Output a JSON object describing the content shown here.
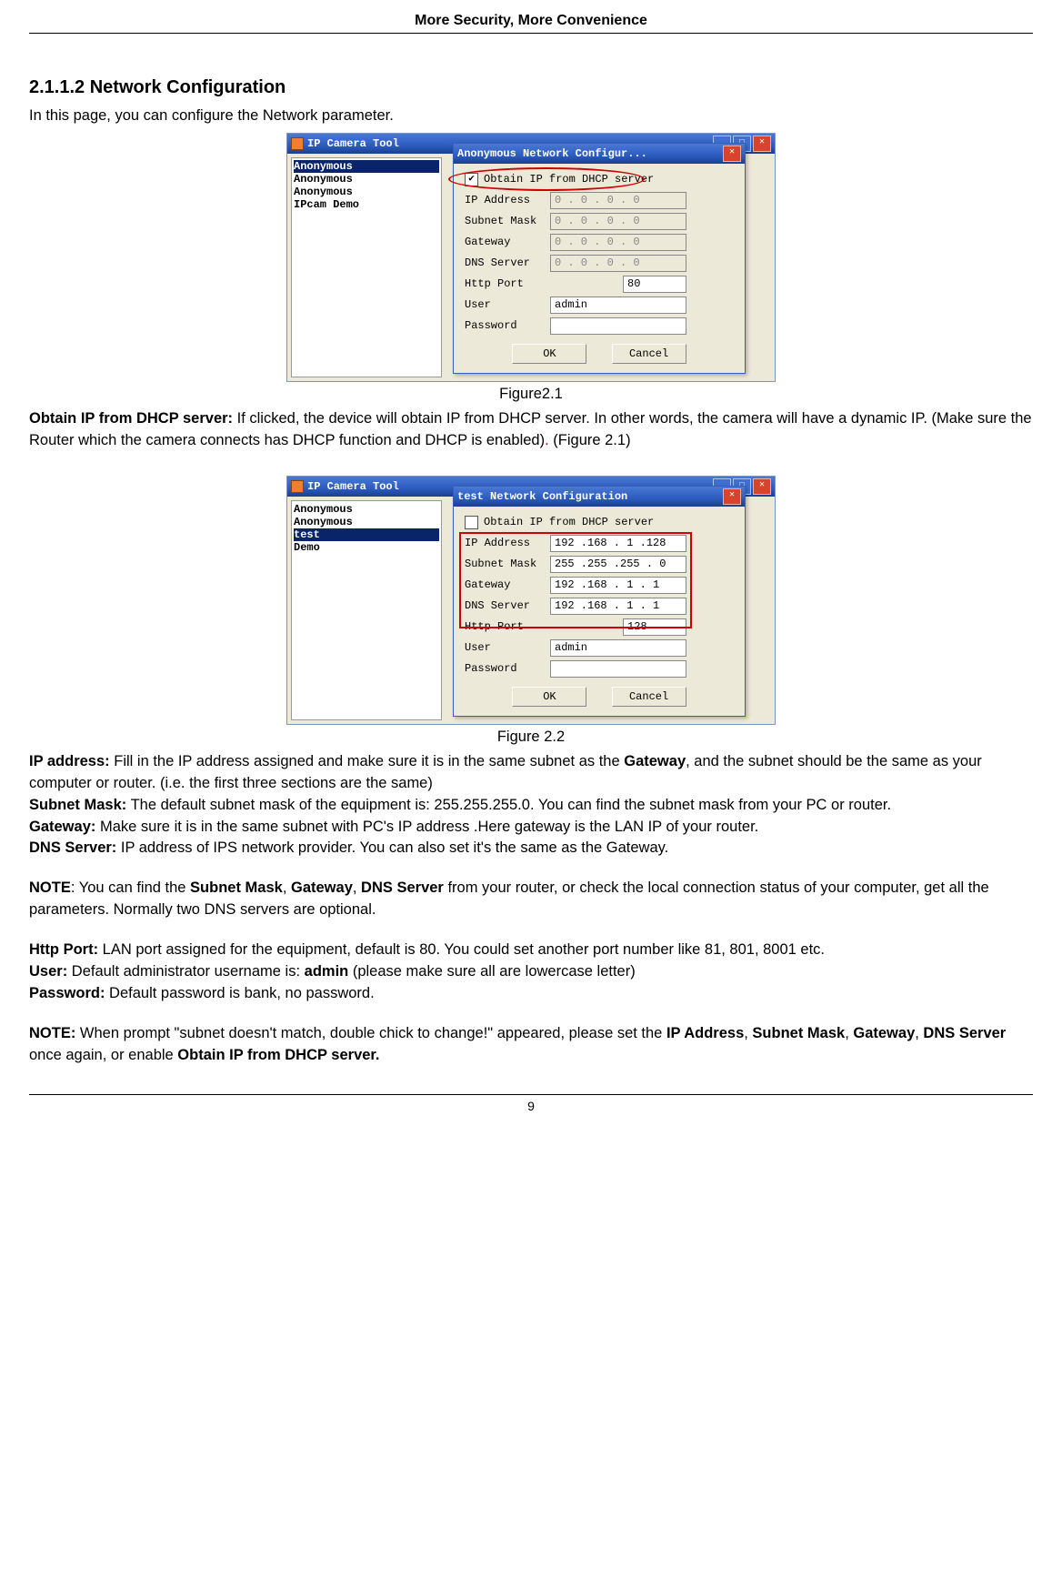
{
  "header": "More Security, More Convenience",
  "section_title": "2.1.1.2 Network Configuration",
  "intro": "In this page, you can configure the Network parameter.",
  "fig1": {
    "caption": "Figure2.1",
    "main_window": {
      "title": "IP Camera Tool",
      "min": "_",
      "max": "☐",
      "close": "✕",
      "sidebar": [
        "Anonymous",
        "Anonymous",
        "Anonymous",
        "IPcam Demo"
      ],
      "selected_index": 0
    },
    "dialog": {
      "title": "Anonymous Network Configur...",
      "close": "✕",
      "checkbox_checked": true,
      "checkbox_label": "Obtain IP from DHCP server",
      "rows": [
        {
          "label": "IP Address",
          "value": "0 . 0 . 0 . 0",
          "disabled": true
        },
        {
          "label": "Subnet Mask",
          "value": "0 . 0 . 0 . 0",
          "disabled": true
        },
        {
          "label": "Gateway",
          "value": "0 . 0 . 0 . 0",
          "disabled": true
        },
        {
          "label": "DNS Server",
          "value": "0 . 0 . 0 . 0",
          "disabled": true
        }
      ],
      "http_port_label": "Http Port",
      "http_port": "80",
      "user_label": "User",
      "user": "admin",
      "password_label": "Password",
      "password": "",
      "ok": "OK",
      "cancel": "Cancel"
    }
  },
  "para_obtain_label": "Obtain IP from DHCP server:",
  "para_obtain_body": " If clicked, the device will obtain IP from DHCP server. In other words, the camera will have a dynamic IP. (Make sure the Router which the camera connects has DHCP function and DHCP is enabled)",
  "para_obtain_tail_red": ".",
  "para_obtain_tail2": " (Figure 2.1)",
  "fig2": {
    "caption": "Figure 2.2",
    "main_window": {
      "title": "IP Camera Tool",
      "sidebar": [
        "Anonymous",
        "Anonymous",
        "test",
        "Demo"
      ],
      "selected_index": 2
    },
    "dialog": {
      "title": "test Network Configuration",
      "close": "✕",
      "checkbox_checked": false,
      "checkbox_label": "Obtain IP from DHCP server",
      "rows": [
        {
          "label": "IP Address",
          "value": "192 .168 . 1  .128",
          "disabled": false
        },
        {
          "label": "Subnet Mask",
          "value": "255 .255 .255 . 0",
          "disabled": false
        },
        {
          "label": "Gateway",
          "value": "192 .168 . 1  . 1",
          "disabled": false
        },
        {
          "label": "DNS Server",
          "value": "192 .168 . 1  . 1",
          "disabled": false
        }
      ],
      "http_port_label": "Http Port",
      "http_port": "128",
      "user_label": "User",
      "user": "admin",
      "password_label": "Password",
      "password": "",
      "ok": "OK",
      "cancel": "Cancel"
    }
  },
  "ip_label": "IP address:",
  "ip_body1": " Fill in the IP address assigned and make sure it is in the same subnet as the ",
  "ip_gateway_bold": "Gateway",
  "ip_body2": ", and the subnet should be the same as your computer or router. (i.e. the first three sections are the same)",
  "subnet_label": "Subnet Mask:",
  "subnet_body": " The default subnet mask of the equipment is: 255.255.255.0. You can find the subnet mask from your PC or router.",
  "gateway_label": "Gateway:",
  "gateway_body": " Make sure it is in the same subnet with PC's IP address .Here gateway is the LAN IP of your router.",
  "dns_label": "DNS Server:",
  "dns_body": " IP address of IPS network provider. You can also set it's the same as the Gateway.",
  "note1_label": "NOTE",
  "note1_body1": ": You can find the ",
  "note1_b1": "Subnet Mask",
  "note1_c1": ", ",
  "note1_b2": "Gateway",
  "note1_c2": ", ",
  "note1_b3": "DNS Server",
  "note1_body2": " from your router, or check the local connection status of your computer, get all the parameters. Normally two DNS servers are optional.",
  "http_label": "Http Port:",
  "http_body": " LAN port assigned for the equipment, default is 80. You could set another port number like 81, 801, 8001 etc.",
  "user_label": "User:",
  "user_body1": " Default administrator username is: ",
  "user_admin": "admin",
  "user_body2": " (please make sure all are lowercase letter)",
  "pass_label": "Password:",
  "pass_body": " Default password is bank, no password.",
  "note2_label": "NOTE:",
  "note2_body1": " When prompt \"subnet doesn't match, double chick to change!\" appeared, please set the ",
  "note2_b1": "IP Address",
  "note2_c1": ", ",
  "note2_b2": "Subnet Mask",
  "note2_c2": ", ",
  "note2_b3": "Gateway",
  "note2_c3": ", ",
  "note2_b4": "DNS Server",
  "note2_body2": " once again, or enable ",
  "note2_b5": "Obtain IP from DHCP server.",
  "page_number": "9"
}
